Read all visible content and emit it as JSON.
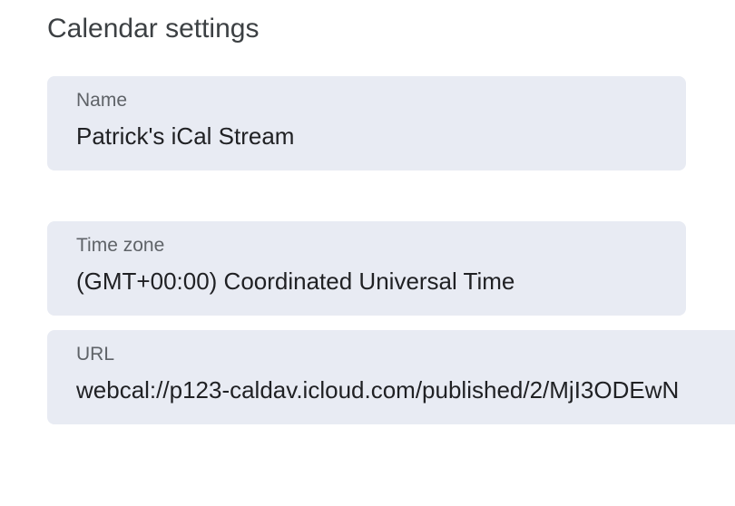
{
  "section": {
    "title": "Calendar settings"
  },
  "fields": {
    "name": {
      "label": "Name",
      "value": "Patrick's iCal Stream"
    },
    "time_zone": {
      "label": "Time zone",
      "value": "(GMT+00:00) Coordinated Universal Time"
    },
    "url": {
      "label": "URL",
      "value": "webcal://p123-caldav.icloud.com/published/2/MjI3ODEwN"
    }
  },
  "colors": {
    "field_background": "#e8ebf3",
    "label_text": "#5f6368",
    "value_text": "#202124",
    "title_text": "#3c4043"
  }
}
